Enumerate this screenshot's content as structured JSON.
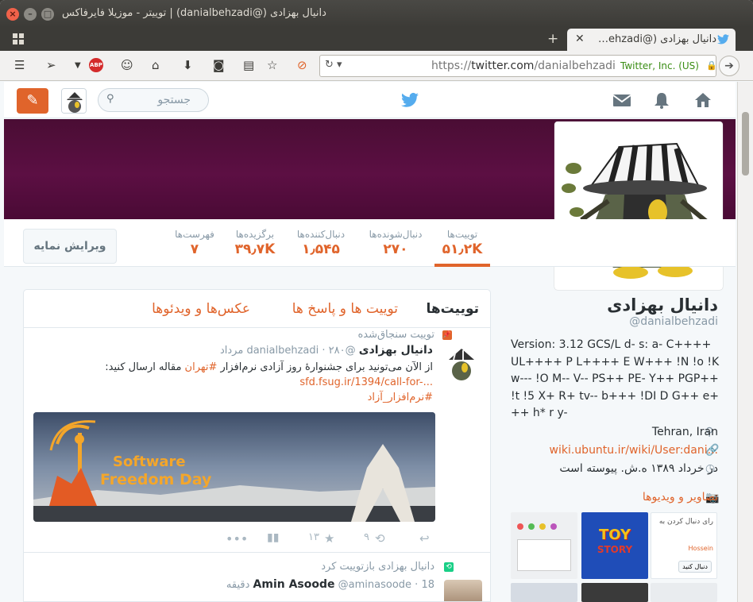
{
  "window": {
    "title": "دانیال بهزادی (@danialbehzadi) | توییتر - موزیلا فایرفاکس"
  },
  "tab": {
    "title": "دانیال بهزادی (@danialbehzadi) ..."
  },
  "urlbar": {
    "url_prefix": "https://",
    "url_host": "twitter.com",
    "url_path": "/danialbehzadi",
    "identity": "Twitter, Inc. (US)"
  },
  "header": {
    "search_placeholder": "جستجو",
    "tweet_button_icon": "compose-icon"
  },
  "profile_nav": {
    "edit_label": "ویرایش نمایه",
    "stats": [
      {
        "label": "توییت‌ها",
        "value": "۵۱٫۲K"
      },
      {
        "label": "دنبال‌شونده‌ها",
        "value": "۲۷۰"
      },
      {
        "label": "دنبال‌کننده‌ها",
        "value": "۱٫۵۴۵"
      },
      {
        "label": "برگزیده‌ها",
        "value": "۳۹٫۷K"
      },
      {
        "label": "فهرست‌ها",
        "value": "۷"
      }
    ]
  },
  "timeline": {
    "tabs": [
      "توییت‌ها",
      "توییت ها و پاسخ ها",
      "عکس‌ها و ویدئوها"
    ],
    "pinned": {
      "label": "توییت سنجاق‌شده",
      "name": "دانیال بهزادی",
      "handle": "@danialbehzadi",
      "date": "۲۸۰ مرداد",
      "text_line1_a": "از الآن می‌تونید برای جشنوارهٔ روز آزادی نرم‌افزار ",
      "text_hashtag1": "#تهران",
      "text_line1_b": " مقاله ارسال کنید:",
      "text_link": "sfd.fsug.ir/1394/call-for-...",
      "text_hashtag2": "#نرم‌افزار_آزاد",
      "media_caption_line1": "Software",
      "media_caption_line2": "Freedom Day",
      "retweets": "۹",
      "favorites": "۱۳"
    },
    "retweet": {
      "label": "دانیال بهزادی بازتوییت کرد",
      "name": "Amin Asoode",
      "handle": "@aminasoode",
      "time": "18 دقیقه"
    }
  },
  "profile": {
    "name": "دانیال بهزادی",
    "handle": "@danialbehzadi",
    "bio": "Version: 3.12 GCS/L d- s: a- C++++ UL++++ P L++++ E W+++ !N !o !K w--- !O M-- V-- PS++ PE- Y++ PGP++ !t !5 X+ R+ tv-- b+++ !DI D G++ e+++ h* r y-",
    "location": "Tehran, Iran",
    "website": "wiki.ubuntu.ir/wiki/User:dani...",
    "joined": "در خرداد ۱۳۸۹ ه.ش. پیوسته است",
    "media_title": "تصاویر و ویدیوها",
    "thumb_toy_line1": "TOY",
    "thumb_toy_line2": "STORY",
    "thumb_follow_text": "رای دنبال کردن به",
    "thumb_follow_btn": "دنبال کنید",
    "thumb_follow_user": "Hossein"
  },
  "colors": {
    "accent": "#e0642b",
    "banner": "#5c0f43"
  }
}
